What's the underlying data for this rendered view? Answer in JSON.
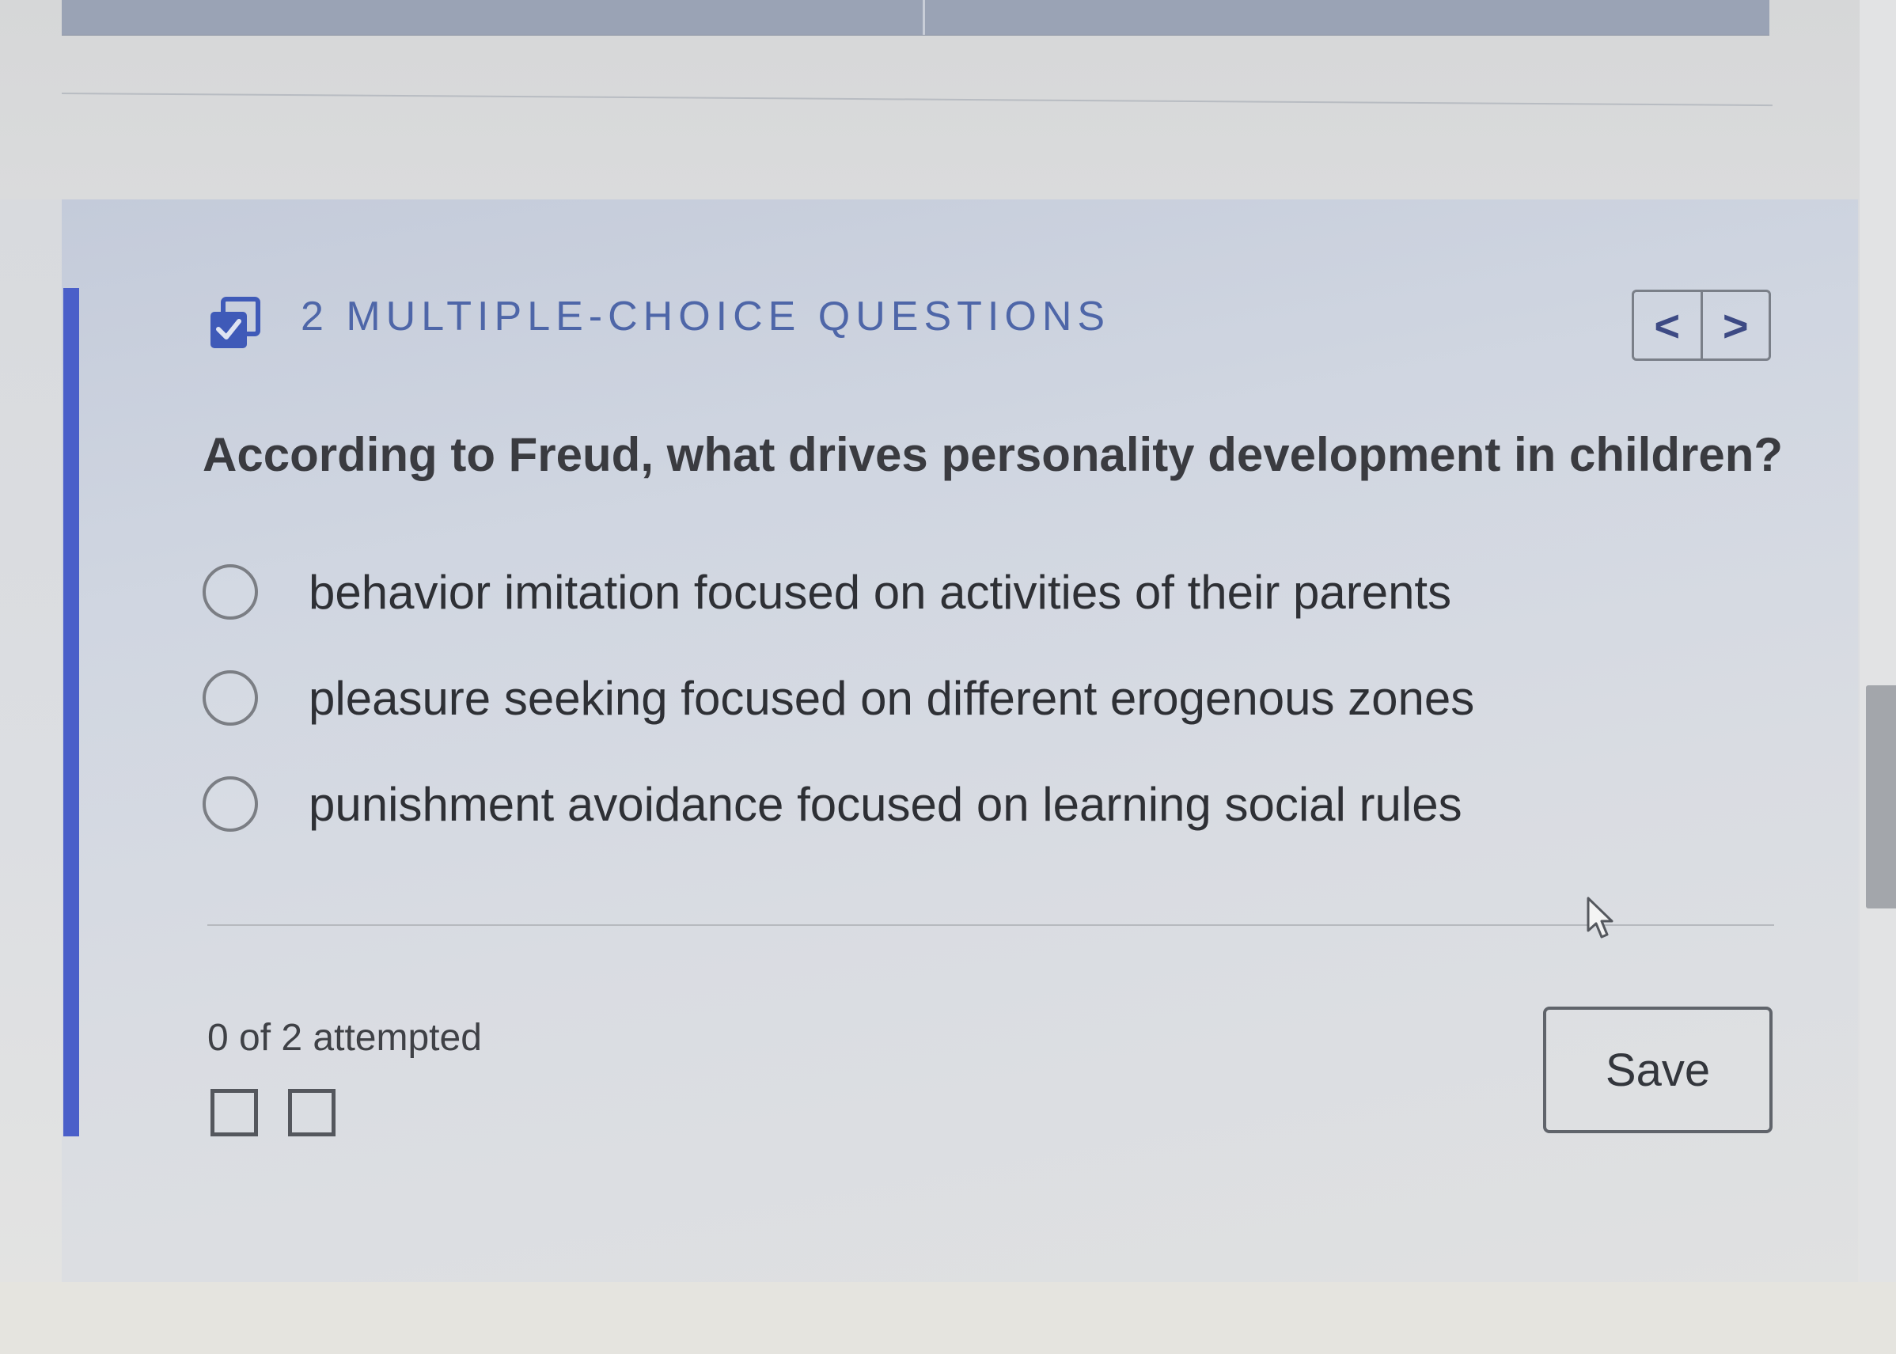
{
  "header": {
    "section_title": "2 MULTIPLE-CHOICE QUESTIONS",
    "icon": "multiple-choice-icon",
    "nav_prev": "<",
    "nav_next": ">"
  },
  "question": {
    "text": "According to Freud, what drives personality development in children?",
    "options": [
      {
        "label": "behavior imitation focused on activities of their parents",
        "selected": false
      },
      {
        "label": "pleasure seeking focused on different erogenous zones",
        "selected": false
      },
      {
        "label": "punishment avoidance focused on learning social rules",
        "selected": false
      }
    ]
  },
  "footer": {
    "attempted": "0 of 2 attempted",
    "progress": [
      false,
      false
    ],
    "save_label": "Save"
  },
  "colors": {
    "accent": "#4a5fc9",
    "title": "#4e66a8"
  }
}
